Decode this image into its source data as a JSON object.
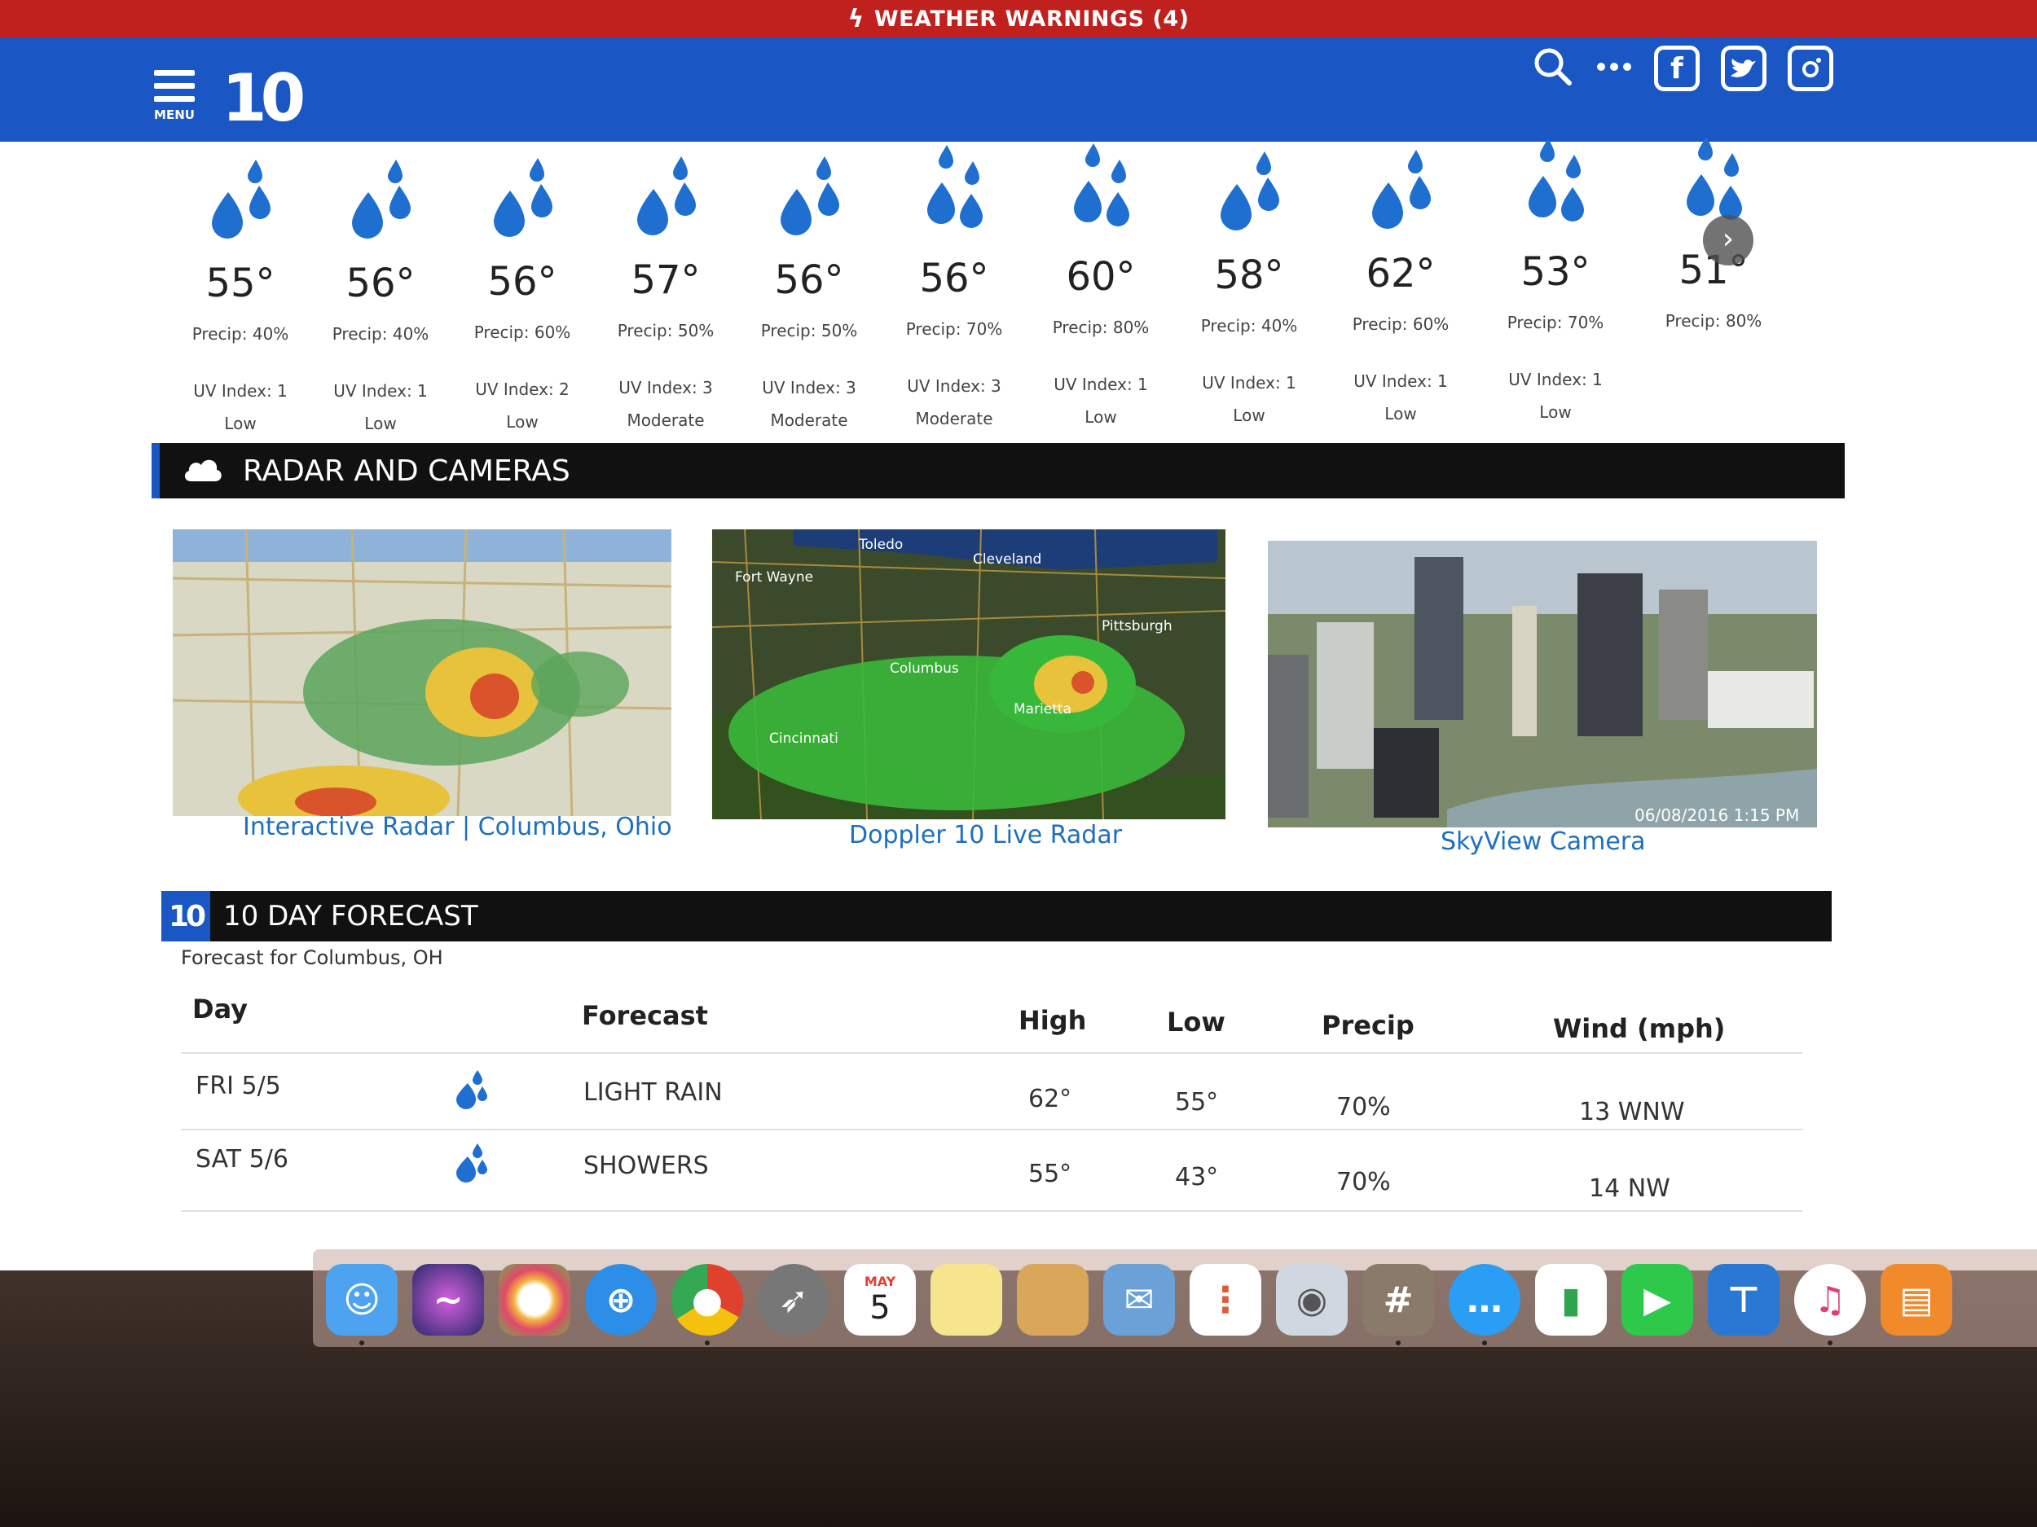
{
  "warning_bar": {
    "label": "WEATHER WARNINGS (4)"
  },
  "header": {
    "menu_label": "MENU",
    "logo": "10",
    "icons": [
      "search-icon",
      "more-icon",
      "facebook-icon",
      "twitter-icon",
      "instagram-icon"
    ]
  },
  "hourly": [
    {
      "temp": "55°",
      "precip": "Precip: 40%",
      "uv": "UV Index: 1",
      "uv_level": "Low"
    },
    {
      "temp": "56°",
      "precip": "Precip: 40%",
      "uv": "UV Index: 1",
      "uv_level": "Low"
    },
    {
      "temp": "56°",
      "precip": "Precip: 60%",
      "uv": "UV Index: 2",
      "uv_level": "Low"
    },
    {
      "temp": "57°",
      "precip": "Precip: 50%",
      "uv": "UV Index: 3",
      "uv_level": "Moderate"
    },
    {
      "temp": "56°",
      "precip": "Precip: 50%",
      "uv": "UV Index: 3",
      "uv_level": "Moderate"
    },
    {
      "temp": "56°",
      "precip": "Precip: 70%",
      "uv": "UV Index: 3",
      "uv_level": "Moderate"
    },
    {
      "temp": "60°",
      "precip": "Precip: 80%",
      "uv": "UV Index: 1",
      "uv_level": "Low"
    },
    {
      "temp": "58°",
      "precip": "Precip: 40%",
      "uv": "UV Index: 1",
      "uv_level": "Low"
    },
    {
      "temp": "62°",
      "precip": "Precip: 60%",
      "uv": "UV Index: 1",
      "uv_level": "Low"
    },
    {
      "temp": "53°",
      "precip": "Precip: 70%",
      "uv": "UV Index: 1",
      "uv_level": "Low"
    },
    {
      "temp": "51°",
      "precip": "Precip: 80%",
      "uv": "",
      "uv_level": ""
    }
  ],
  "radar_section": {
    "title": "RADAR AND CAMERAS",
    "links": [
      "Interactive Radar | Columbus, Ohio",
      "Doppler 10 Live Radar",
      "SkyView Camera"
    ],
    "map_labels": {
      "toledo": "Toledo",
      "cleveland": "Cleveland",
      "fort_wayne": "Fort Wayne",
      "pittsburgh": "Pittsburgh",
      "columbus": "Columbus",
      "marietta": "Marietta",
      "cincinnati": "Cincinnati"
    },
    "camera_timestamp": "06/08/2016 1:15 PM"
  },
  "forecast_section": {
    "logo": "10",
    "title": "10 DAY FORECAST",
    "subtitle": "Forecast for Columbus, OH",
    "columns": [
      "Day",
      "Forecast",
      "High",
      "Low",
      "Precip",
      "Wind (mph)"
    ],
    "rows": [
      {
        "day": "FRI 5/5",
        "forecast": "LIGHT RAIN",
        "high": "62°",
        "low": "55°",
        "precip": "70%",
        "wind": "13 WNW"
      },
      {
        "day": "SAT 5/6",
        "forecast": "SHOWERS",
        "high": "55°",
        "low": "43°",
        "precip": "70%",
        "wind": "14 NW"
      }
    ]
  },
  "dock": {
    "calendar_month": "MAY",
    "calendar_day": "5",
    "apps": [
      "finder-icon",
      "siri-icon",
      "photos-icon",
      "safari-icon",
      "chrome-icon",
      "launchpad-icon",
      "calendar-icon",
      "notes-icon",
      "preview-icon",
      "mail-icon",
      "reminders-icon",
      "photo-booth-icon",
      "calculator-icon",
      "messages-icon",
      "numbers-icon",
      "facetime-icon",
      "keynote-icon",
      "itunes-icon",
      "ibooks-icon"
    ]
  },
  "colors": {
    "accent": "#1a56c4",
    "warning": "#c0201e",
    "link": "#1d6fc0",
    "rain": "#1f6fd1"
  }
}
